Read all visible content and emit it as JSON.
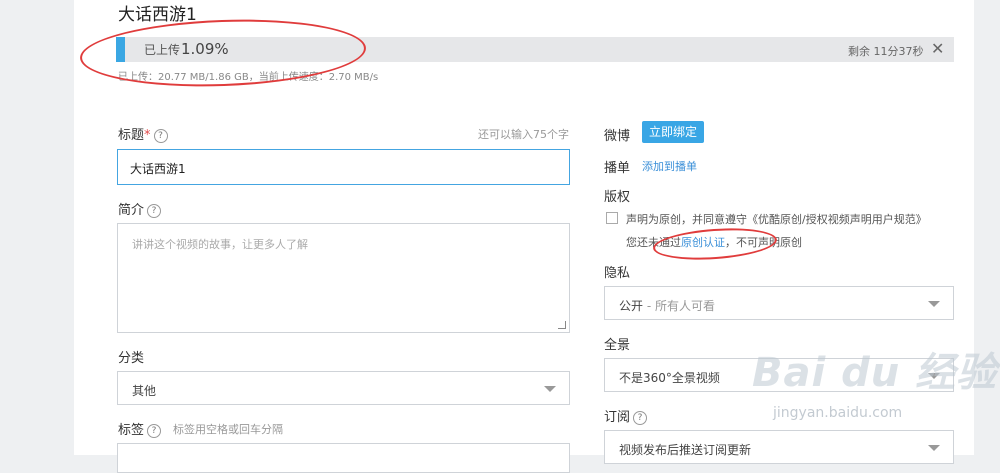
{
  "page": {
    "title": "大话西游1"
  },
  "upload": {
    "label": "已上传",
    "percent_text": "1.09%",
    "progress_fraction": 0.0109,
    "remaining": "剩余 11分37秒",
    "info": "已上传：20.77 MB/1.86 GB，当前上传速度：2.70 MB/s"
  },
  "form": {
    "title_label": "标题",
    "title_required_mark": "*",
    "title_hint": "还可以输入75个字",
    "title_value": "大话西游1",
    "intro_label": "简介",
    "intro_placeholder": "讲讲这个视频的故事，让更多人了解",
    "category_label": "分类",
    "category_value": "其他",
    "tags_label": "标签",
    "tags_hint": "标签用空格或回车分隔"
  },
  "side": {
    "weibo_label": "微博",
    "weibo_button": "立即绑定",
    "playlist_label": "播单",
    "playlist_link": "添加到播单",
    "copyright_label": "版权",
    "copyright_check_text": "声明为原创，并同意遵守《优酷原创/授权视频声明用户规范》",
    "copyright_note_prefix": "您还未通过",
    "copyright_note_link": "原创认证",
    "copyright_note_suffix": "，不可声明原创",
    "privacy_label": "隐私",
    "privacy_value": "公开",
    "privacy_sub": " - 所有人可看",
    "panorama_label": "全景",
    "panorama_value": "不是360°全景视频",
    "subscribe_label": "订阅",
    "subscribe_value": "视频发布后推送订阅更新"
  },
  "watermark": {
    "main": "Bai du 经验",
    "sub": "jingyan.baidu.com"
  },
  "colors": {
    "accent": "#39a6e5",
    "annotation": "#e03c3c",
    "progress": "#3aa7e3"
  },
  "icons": {
    "close": "close-icon",
    "help": "question-icon",
    "dropdown": "caret-down-icon"
  }
}
